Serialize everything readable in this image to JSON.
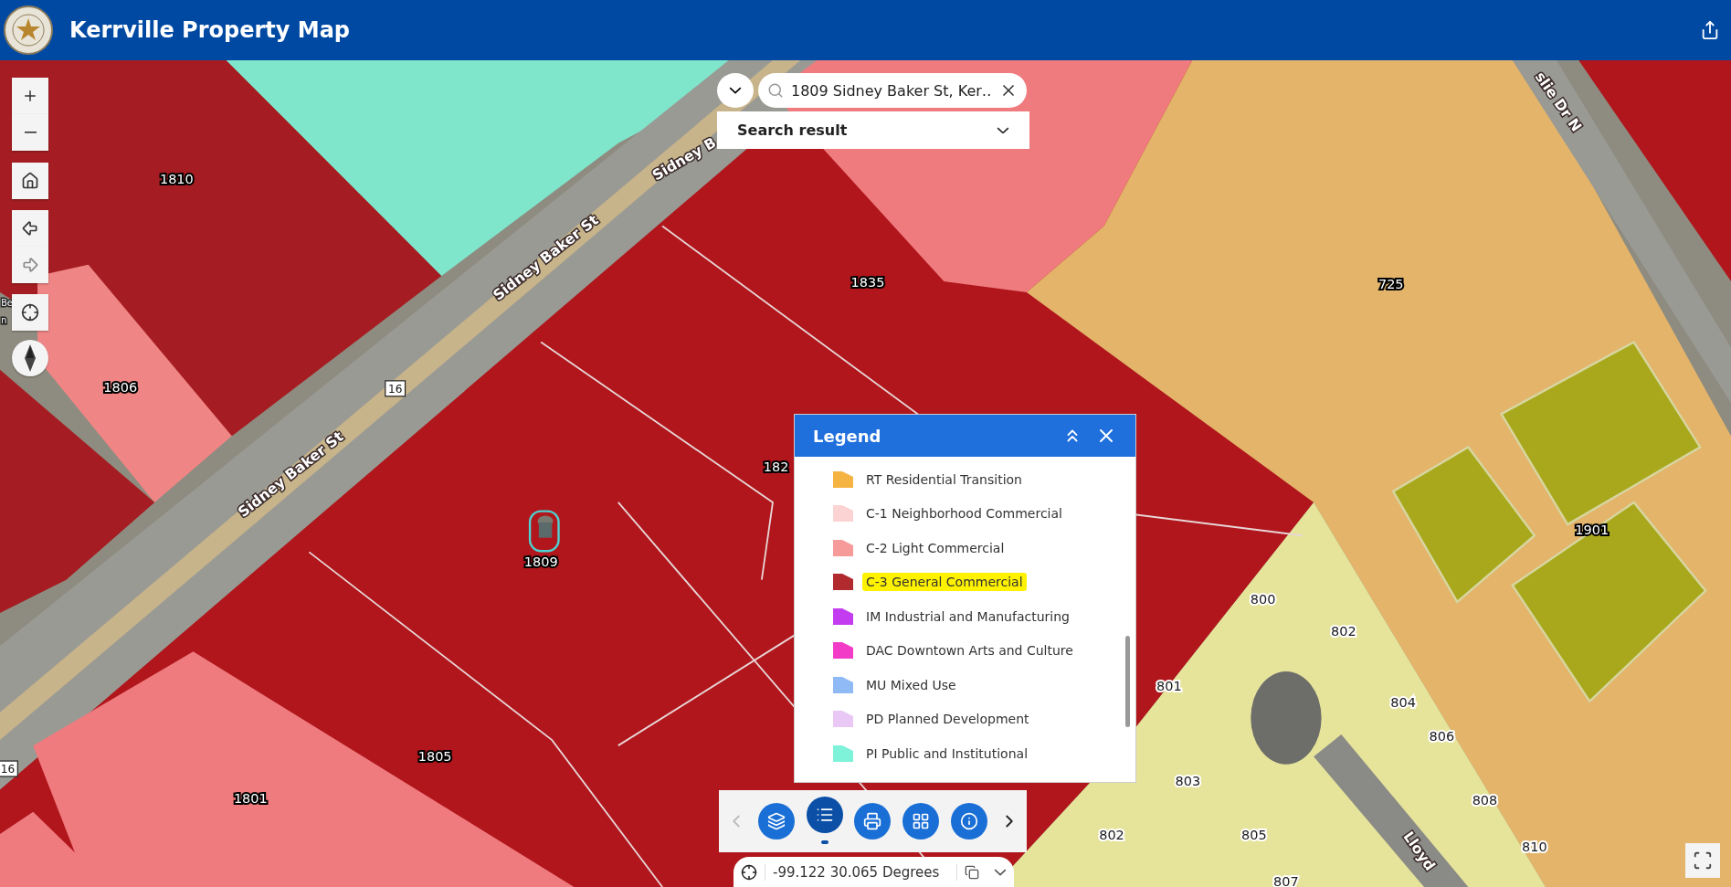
{
  "header": {
    "title": "Kerrville Property Map"
  },
  "search": {
    "value": "1809 Sidney Baker St, Ker…",
    "result_label": "Search result"
  },
  "map": {
    "parcel_labels": [
      "1810",
      "1806",
      "1835",
      "725",
      "182",
      "1809",
      "1805",
      "1801",
      "1901",
      "800",
      "802",
      "801",
      "804",
      "806",
      "803",
      "808",
      "805",
      "802",
      "810",
      "807"
    ],
    "street_labels": [
      "Sidney Baker St",
      "Sidney Baker St",
      "Sidney B",
      "slie Dr N",
      "Lloyd"
    ],
    "route_shields": [
      "16",
      "16"
    ],
    "edge_labels": [
      "Be",
      "n"
    ]
  },
  "legend": {
    "title": "Legend",
    "items": [
      {
        "label": "RT Residential Transition",
        "color": "#f5b342",
        "highlighted": false
      },
      {
        "label": "C-1 Neighborhood Commercial",
        "color": "#fbd3d3",
        "highlighted": false
      },
      {
        "label": "C-2 Light Commercial",
        "color": "#f79a9a",
        "highlighted": false
      },
      {
        "label": "C-3 General Commercial",
        "color": "#b02a2e",
        "highlighted": true
      },
      {
        "label": "IM Industrial and Manufacturing",
        "color": "#c43cf0",
        "highlighted": false
      },
      {
        "label": "DAC Downtown Arts and Culture",
        "color": "#f23cc8",
        "highlighted": false
      },
      {
        "label": "MU Mixed Use",
        "color": "#8fbaf5",
        "highlighted": false
      },
      {
        "label": "PD Planned Development",
        "color": "#e9c8f5",
        "highlighted": false
      },
      {
        "label": "PI Public and Institutional",
        "color": "#7ff2da",
        "highlighted": false
      }
    ]
  },
  "toolbar": {
    "buttons": [
      {
        "kind": "layers",
        "selected": false
      },
      {
        "kind": "legend",
        "selected": true
      },
      {
        "kind": "print",
        "selected": false
      },
      {
        "kind": "basemap",
        "selected": false
      },
      {
        "kind": "about",
        "selected": false
      }
    ]
  },
  "coordinates": {
    "value": "-99.122 30.065 Degrees"
  }
}
